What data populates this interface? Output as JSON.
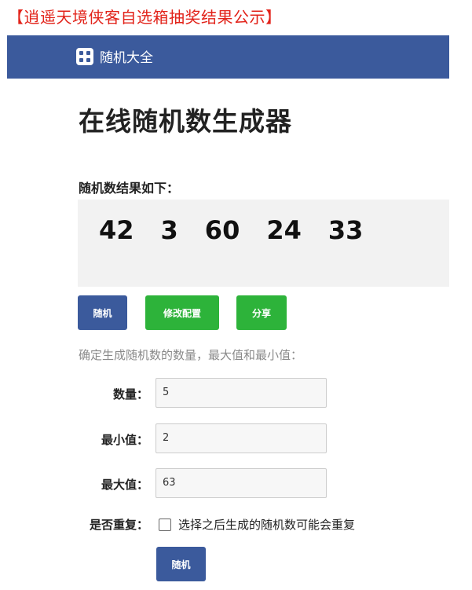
{
  "banner": "【逍遥天境侠客自选箱抽奖结果公示】",
  "nav": {
    "brand_icon": "dice-icon",
    "brand": "随机大全"
  },
  "page_title": "在线随机数生成器",
  "result": {
    "label": "随机数结果如下：",
    "numbers": [
      "42",
      "3",
      "60",
      "24",
      "33"
    ]
  },
  "buttons": {
    "random": "随机",
    "config": "修改配置",
    "share": "分享",
    "submit": "随机"
  },
  "form": {
    "description": "确定生成随机数的数量，最大值和最小值：",
    "count_label": "数量：",
    "count_value": "5",
    "min_label": "最小值：",
    "min_value": "2",
    "max_label": "最大值：",
    "max_value": "63",
    "repeat_label": "是否重复：",
    "repeat_text": "选择之后生成的随机数可能会重复",
    "repeat_checked": false
  },
  "colors": {
    "banner": "#e2231a",
    "nav": "#3b5a9c",
    "primary_button": "#3b5a9c",
    "green_button": "#2db33a"
  }
}
